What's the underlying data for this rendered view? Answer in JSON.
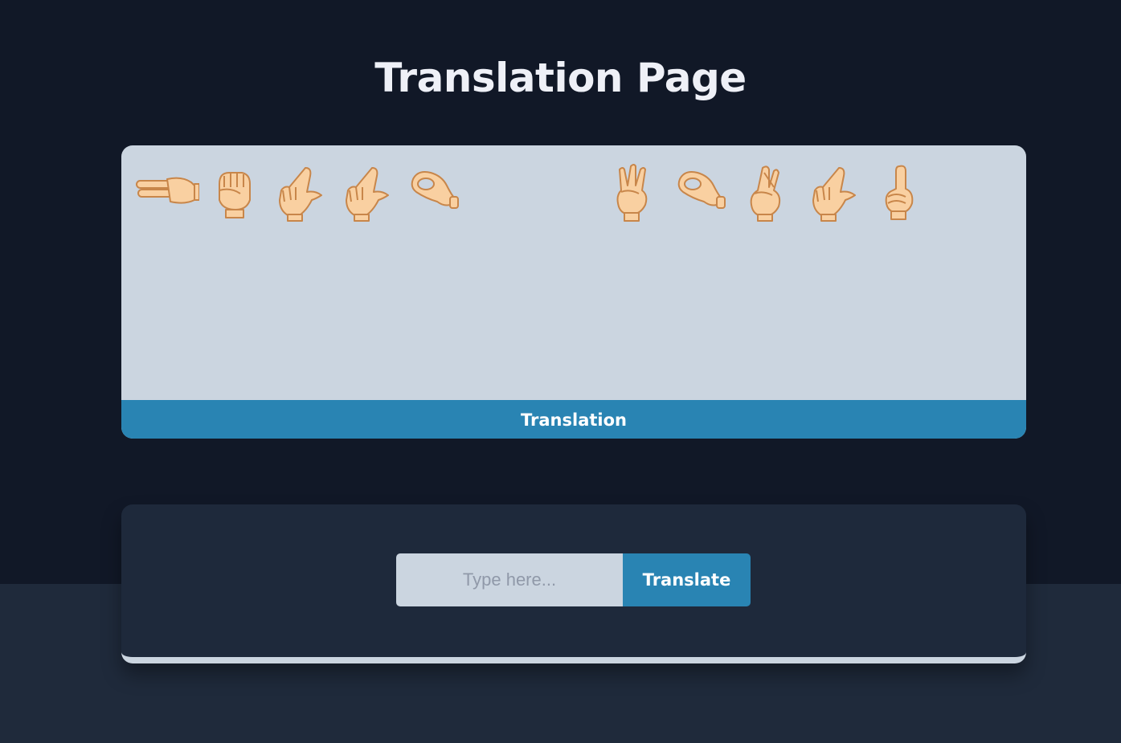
{
  "header": {
    "title": "Translation Page"
  },
  "output_panel": {
    "signs": [
      {
        "name": "sign-t-icon",
        "shape": "point-side"
      },
      {
        "name": "sign-h-icon",
        "shape": "fist"
      },
      {
        "name": "sign-l-icon",
        "shape": "l-hand"
      },
      {
        "name": "sign-l-icon",
        "shape": "l-hand"
      },
      {
        "name": "sign-o-icon",
        "shape": "o-hand"
      },
      {
        "name": "space",
        "shape": "space"
      },
      {
        "name": "sign-w-icon",
        "shape": "w-hand"
      },
      {
        "name": "sign-o-icon",
        "shape": "o-hand"
      },
      {
        "name": "sign-r-icon",
        "shape": "crossed"
      },
      {
        "name": "sign-l-icon",
        "shape": "l-hand"
      },
      {
        "name": "sign-d-icon",
        "shape": "d-hand"
      }
    ],
    "footer_label": "Translation"
  },
  "input_panel": {
    "placeholder": "Type here...",
    "value": "",
    "button_label": "Translate"
  },
  "colors": {
    "background": "#111827",
    "panel": "#1e293b",
    "card": "#cbd5e0",
    "accent": "#2984b3",
    "skin": "#f9d0a1",
    "skin_outline": "#c8864a"
  }
}
